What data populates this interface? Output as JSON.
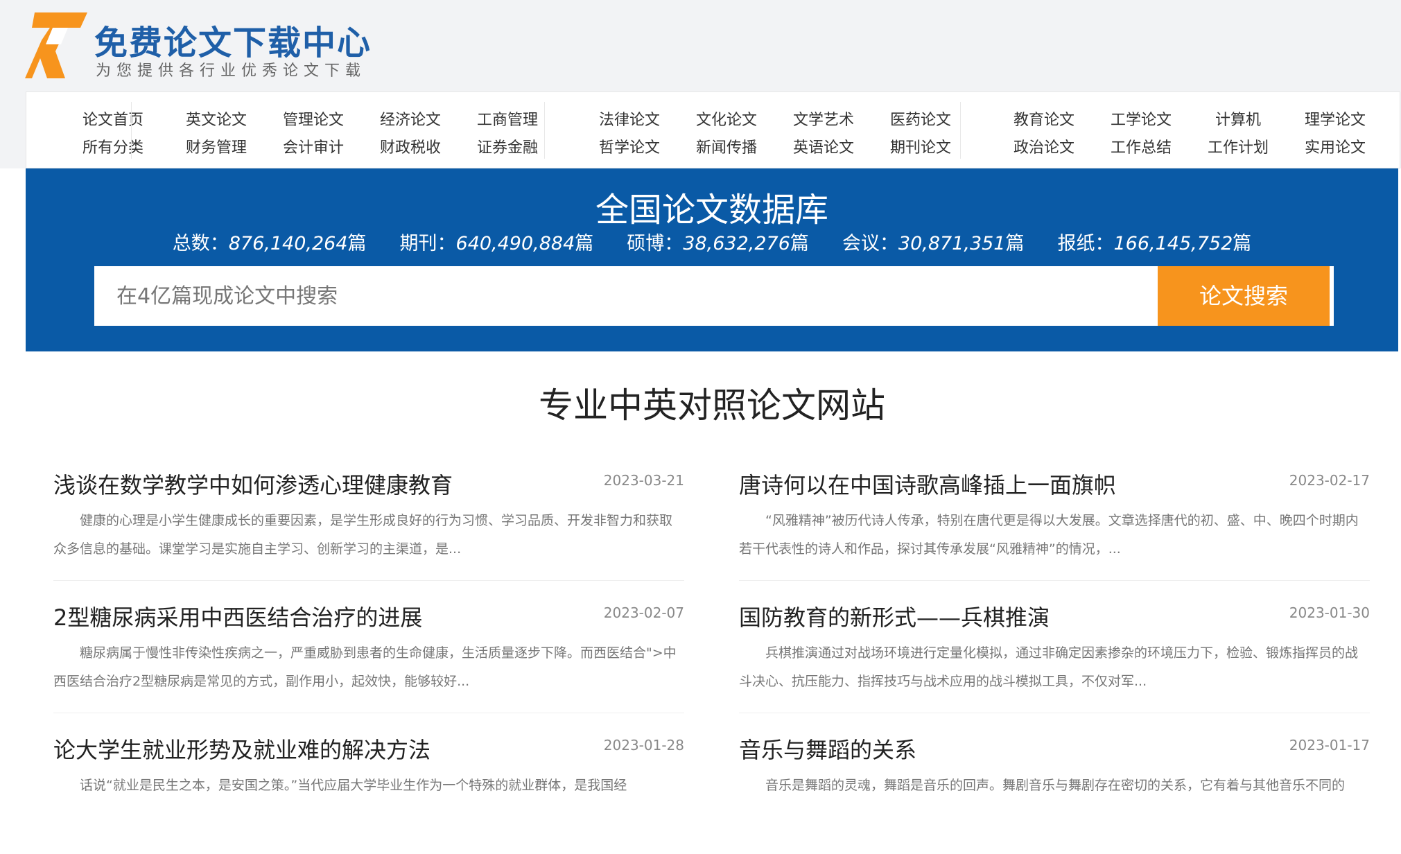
{
  "logo": {
    "title": "免费论文下载中心",
    "subtitle": "为您提供各行业优秀论文下载",
    "colors": {
      "mark": "#f7941d",
      "title": "#1f5fa8"
    }
  },
  "nav": {
    "groups": [
      [
        [
          "论文首页",
          "所有分类"
        ]
      ],
      [
        [
          "英文论文",
          "财务管理"
        ],
        [
          "管理论文",
          "会计审计"
        ],
        [
          "经济论文",
          "财政税收"
        ],
        [
          "工商管理",
          "证券金融"
        ]
      ],
      [
        [
          "法律论文",
          "哲学论文"
        ],
        [
          "文化论文",
          "新闻传播"
        ],
        [
          "文学艺术",
          "英语论文"
        ],
        [
          "医药论文",
          "期刊论文"
        ]
      ],
      [
        [
          "教育论文",
          "政治论文"
        ],
        [
          "工学论文",
          "工作总结"
        ],
        [
          "计算机",
          "工作计划"
        ],
        [
          "理学论文",
          "实用论文"
        ]
      ]
    ]
  },
  "banner": {
    "title": "全国论文数据库",
    "stats": [
      {
        "label": "总数：",
        "value": "876,140,264",
        "unit": "篇"
      },
      {
        "label": "期刊：",
        "value": "640,490,884",
        "unit": "篇"
      },
      {
        "label": "硕博：",
        "value": "38,632,276",
        "unit": "篇"
      },
      {
        "label": "会议：",
        "value": "30,871,351",
        "unit": "篇"
      },
      {
        "label": "报纸：",
        "value": "166,145,752",
        "unit": "篇"
      }
    ],
    "search_placeholder": "在4亿篇现成论文中搜索",
    "search_button": "论文搜索",
    "colors": {
      "background": "#0a5aa6",
      "button": "#f7941d"
    }
  },
  "section_title": "专业中英对照论文网站",
  "articles": [
    {
      "title": "浅谈在数学教学中如何渗透心理健康教育",
      "date": "2023-03-21",
      "summary": "健康的心理是小学生健康成长的重要因素，是学生形成良好的行为习惯、学习品质、开发非智力和获取众多信息的基础。课堂学习是实施自主学习、创新学习的主渠道，是..."
    },
    {
      "title": "唐诗何以在中国诗歌高峰插上一面旗帜",
      "date": "2023-02-17",
      "summary": "“风雅精神”被历代诗人传承，特别在唐代更是得以大发展。文章选择唐代的初、盛、中、晚四个时期内若干代表性的诗人和作品，探讨其传承发展“风雅精神”的情况，..."
    },
    {
      "title": "2型糖尿病采用中西医结合治疗的进展",
      "date": "2023-02-07",
      "summary": "糖尿病属于慢性非传染性疾病之一，严重威胁到患者的生命健康，生活质量逐步下降。而西医结合\">中西医结合治疗2型糖尿病是常见的方式，副作用小，起效快，能够较好..."
    },
    {
      "title": "国防教育的新形式——兵棋推演",
      "date": "2023-01-30",
      "summary": "兵棋推演通过对战场环境进行定量化模拟，通过非确定因素掺杂的环境压力下，检验、锻炼指挥员的战斗决心、抗压能力、指挥技巧与战术应用的战斗模拟工具，不仅对军..."
    },
    {
      "title": "论大学生就业形势及就业难的解决方法",
      "date": "2023-01-28",
      "summary": "话说“就业是民生之本，是安国之策。”当代应届大学毕业生作为一个特殊的就业群体，是我国经"
    },
    {
      "title": "音乐与舞蹈的关系",
      "date": "2023-01-17",
      "summary": "音乐是舞蹈的灵魂，舞蹈是音乐的回声。舞剧音乐与舞剧存在密切的关系，它有着与其他音乐不同的"
    }
  ]
}
